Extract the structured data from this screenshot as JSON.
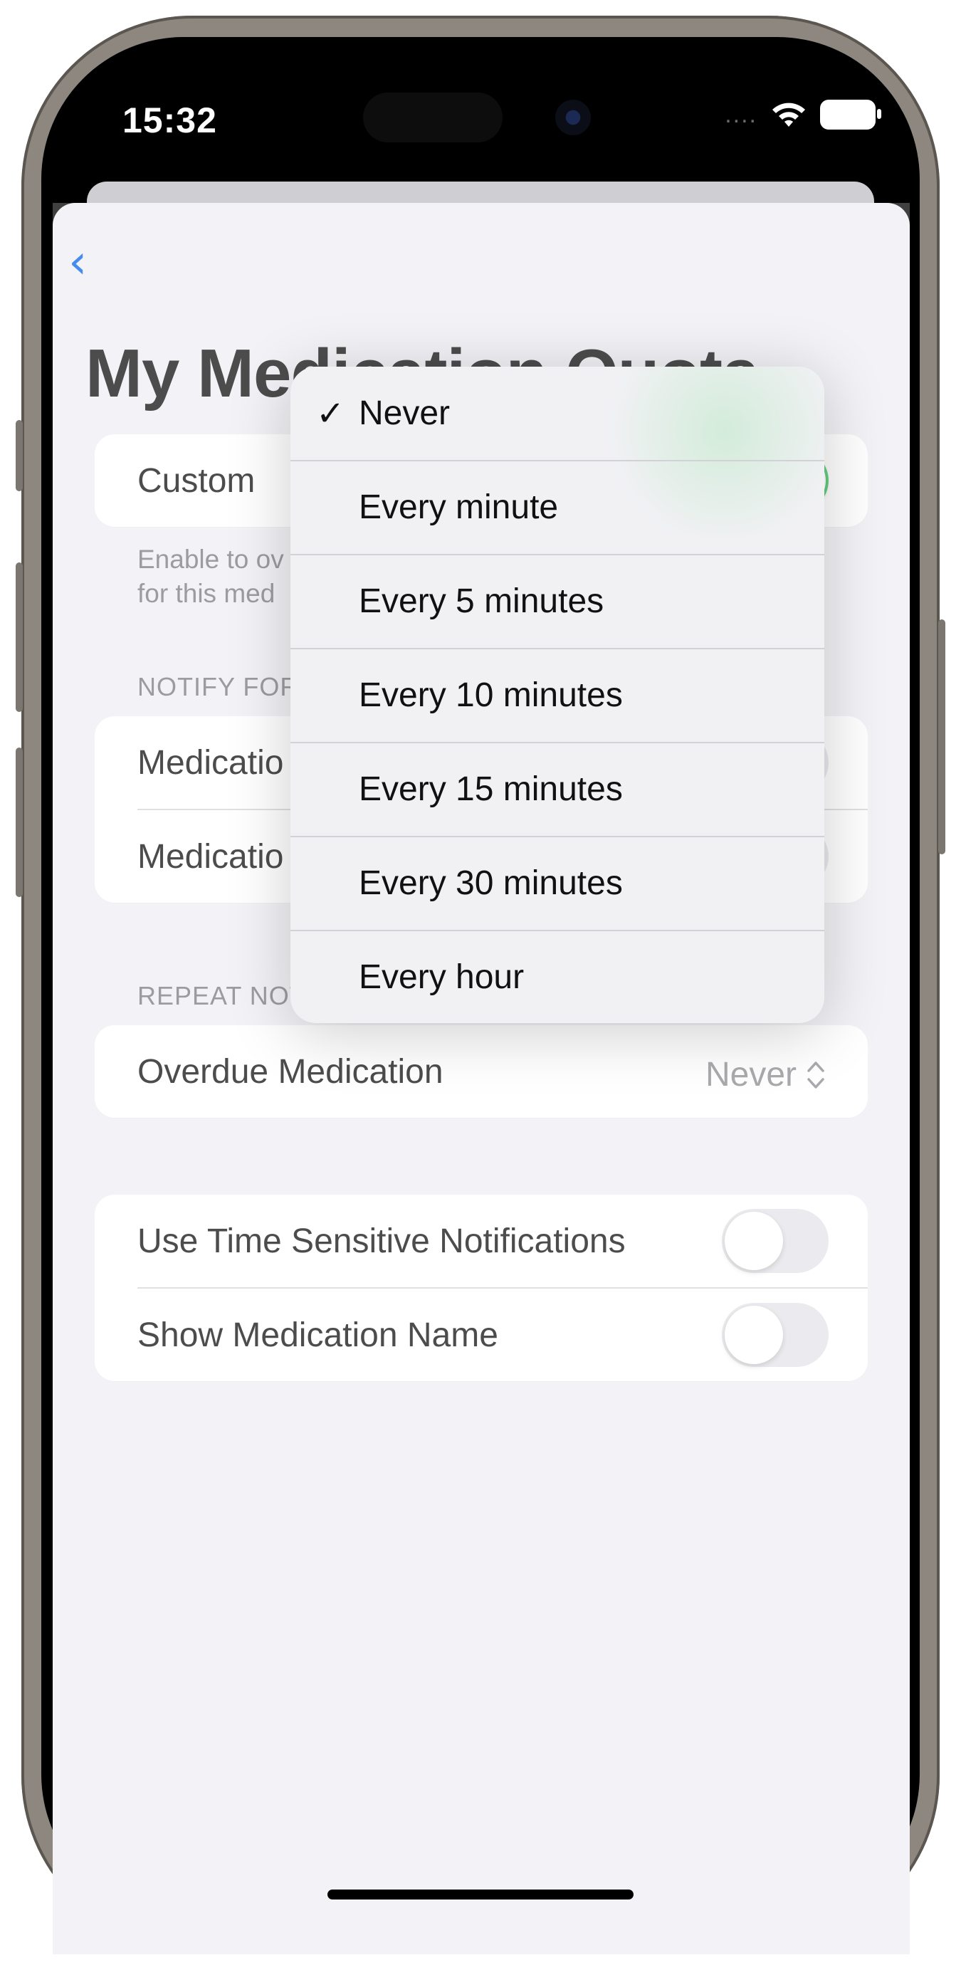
{
  "status_bar": {
    "time": "15:32",
    "signal_dots": "....",
    "icons": [
      "wifi-icon",
      "battery-icon"
    ]
  },
  "nav": {
    "back_icon": "chevron-left-icon",
    "title": "My Medication Quota"
  },
  "custom_card": {
    "label": "Custom",
    "toggle_on": true
  },
  "footnote": {
    "line1": "Enable to ov",
    "line2": "for this med"
  },
  "notify_section": {
    "label": "NOTIFY FOR",
    "rows": [
      {
        "label": "Medicatio",
        "toggle_on": false
      },
      {
        "label": "Medicatio",
        "toggle_on": false
      }
    ]
  },
  "repeat_section": {
    "label": "REPEAT NOT",
    "row": {
      "label": "Overdue Medication",
      "value": "Never"
    }
  },
  "options_card": {
    "rows": [
      {
        "label": "Use Time Sensitive Notifications",
        "toggle_on": false
      },
      {
        "label": "Show Medication Name",
        "toggle_on": false
      }
    ]
  },
  "menu": {
    "selected": "Never",
    "items": [
      {
        "label": "Never"
      },
      {
        "label": "Every minute"
      },
      {
        "label": "Every 5 minutes"
      },
      {
        "label": "Every 10 minutes"
      },
      {
        "label": "Every 15 minutes"
      },
      {
        "label": "Every 30 minutes"
      },
      {
        "label": "Every hour"
      }
    ]
  },
  "colors": {
    "accent": "#0a66e6",
    "toggle_on": "#34c759",
    "background": "#efeff4"
  }
}
